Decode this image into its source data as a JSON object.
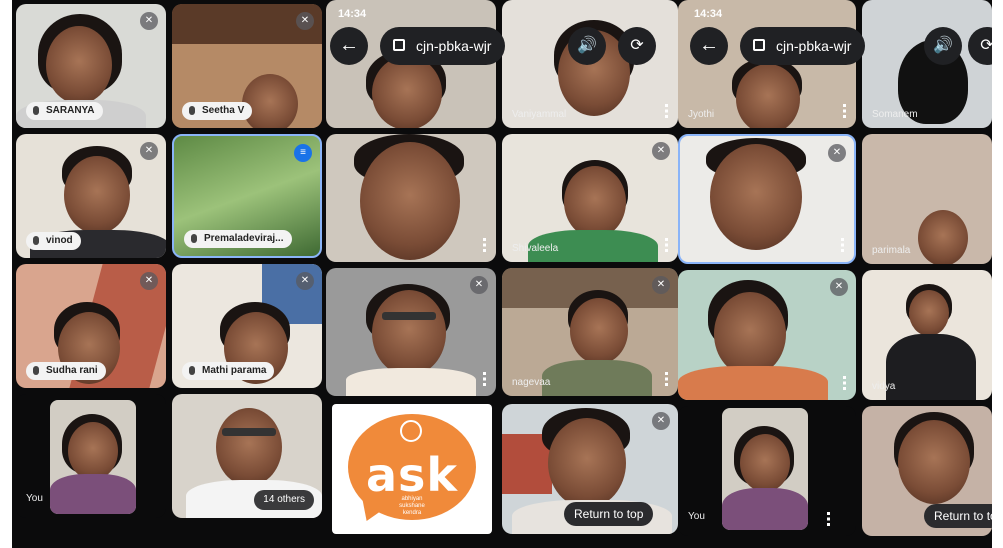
{
  "meeting_code": "cjn-pbka-wjr",
  "status_time": "14:34",
  "return_label": "Return to top",
  "panel1": {
    "tiles": [
      "SARANYA",
      "Seetha V",
      "vinod",
      "Premaladeviraj...",
      "Sudha rani",
      "Mathi parama",
      "You"
    ],
    "others_label": "14 others"
  },
  "panel2": {
    "names": [
      "",
      "Vaniyammal",
      "",
      "Shivaleela",
      "",
      "nagevaa",
      ""
    ],
    "logo": {
      "word": "ask",
      "line1": "abhiyan",
      "line2": "sukshane",
      "line3": "kendra"
    }
  },
  "panel3": {
    "names": [
      "Jyothi",
      "Somanem",
      "",
      "parimala",
      "",
      "vidya",
      "You"
    ]
  },
  "colors": {
    "panel_bg": "#0b0b0c",
    "chip_bg": "#202124",
    "name_chip_bg": "#f3f3f3",
    "ask_orange": "#f08a3a"
  },
  "icons": [
    "microphone-icon",
    "mic-off-icon",
    "arrow-left-icon",
    "calendar-icon",
    "speaker-icon",
    "switch-camera-icon",
    "more-vert-icon",
    "audio-active-icon"
  ]
}
